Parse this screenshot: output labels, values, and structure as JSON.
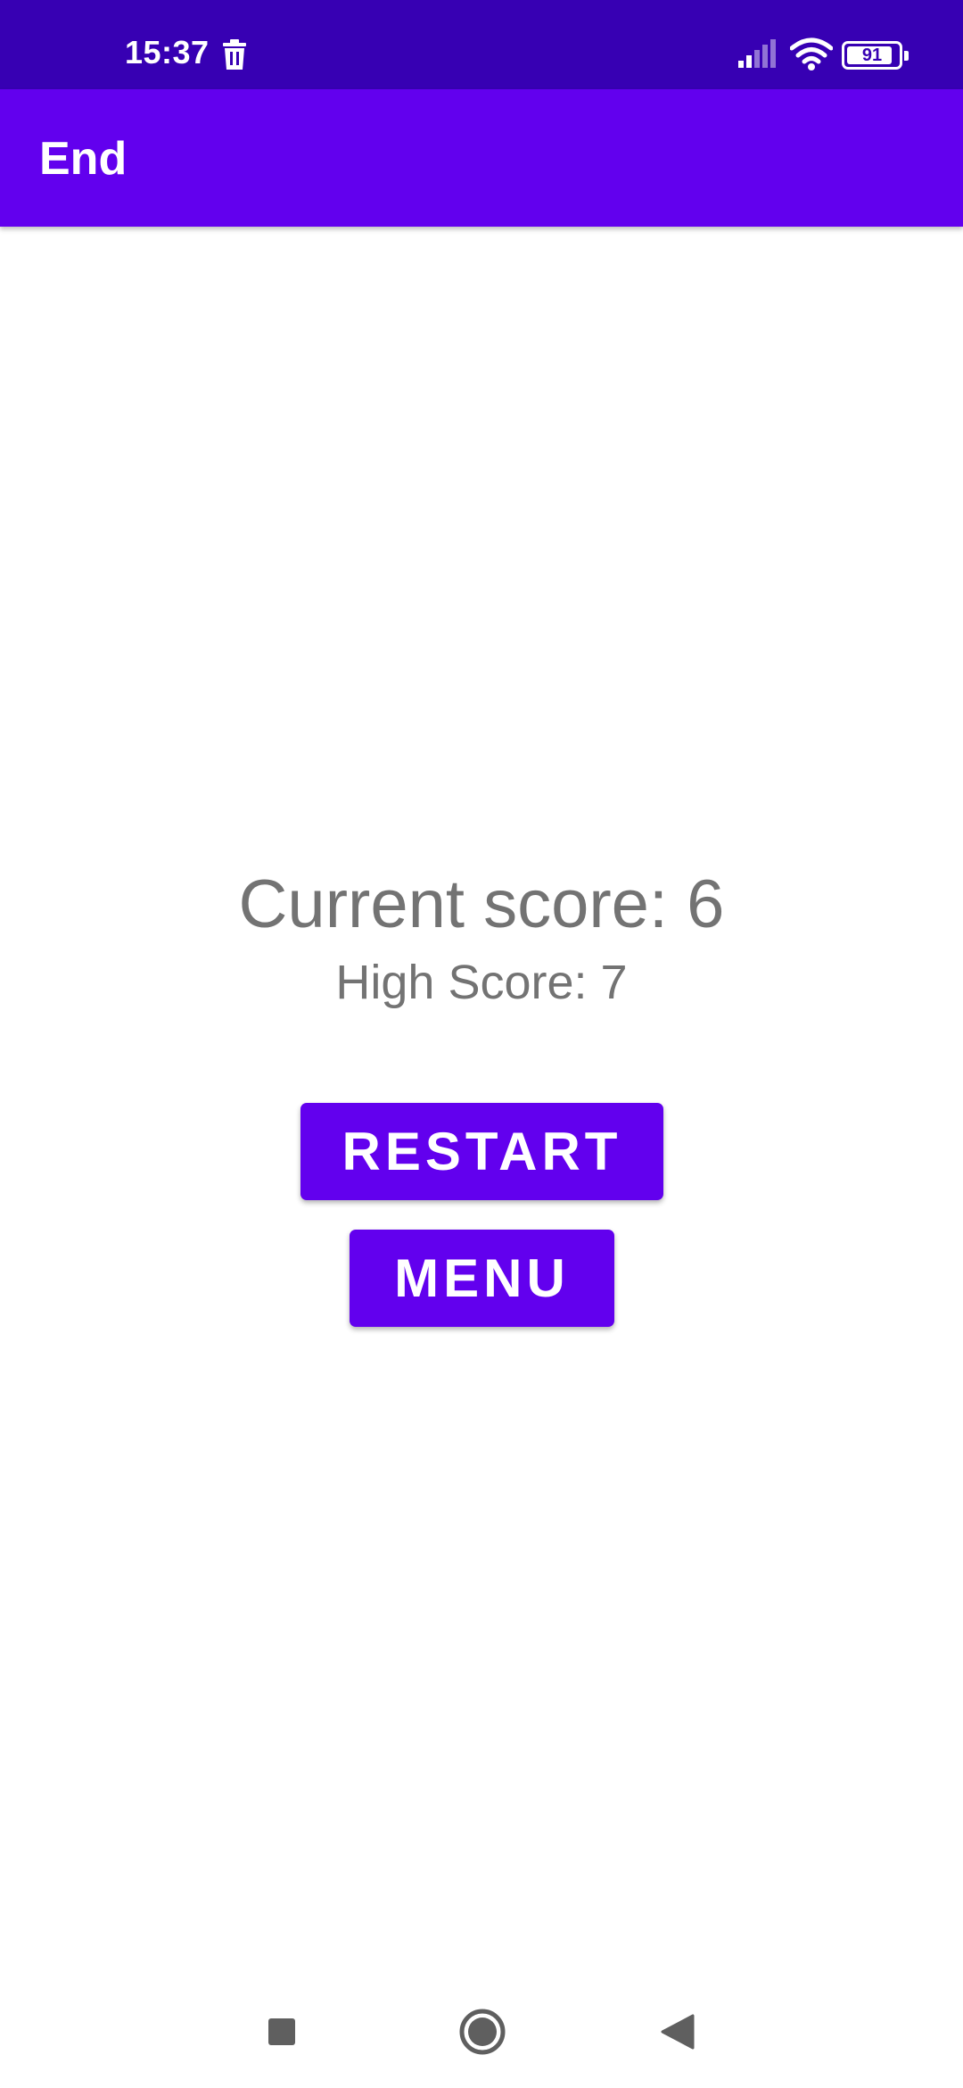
{
  "status_bar": {
    "time": "15:37",
    "battery_level": "91",
    "battery_fraction": 0.91,
    "icons": [
      "trash-icon",
      "signal-icon",
      "wifi-icon",
      "battery-icon"
    ],
    "background_color": "#3700B3"
  },
  "app_bar": {
    "title": "End",
    "background_color": "#6200EE"
  },
  "scores": {
    "current": "Current score: 6",
    "high": "High Score: 7",
    "text_color": "#737373"
  },
  "buttons": {
    "restart_label": "RESTART",
    "menu_label": "MENU",
    "color": "#6200EE"
  },
  "nav_bar": {
    "icons": [
      "recents-icon",
      "home-icon",
      "back-icon"
    ]
  }
}
